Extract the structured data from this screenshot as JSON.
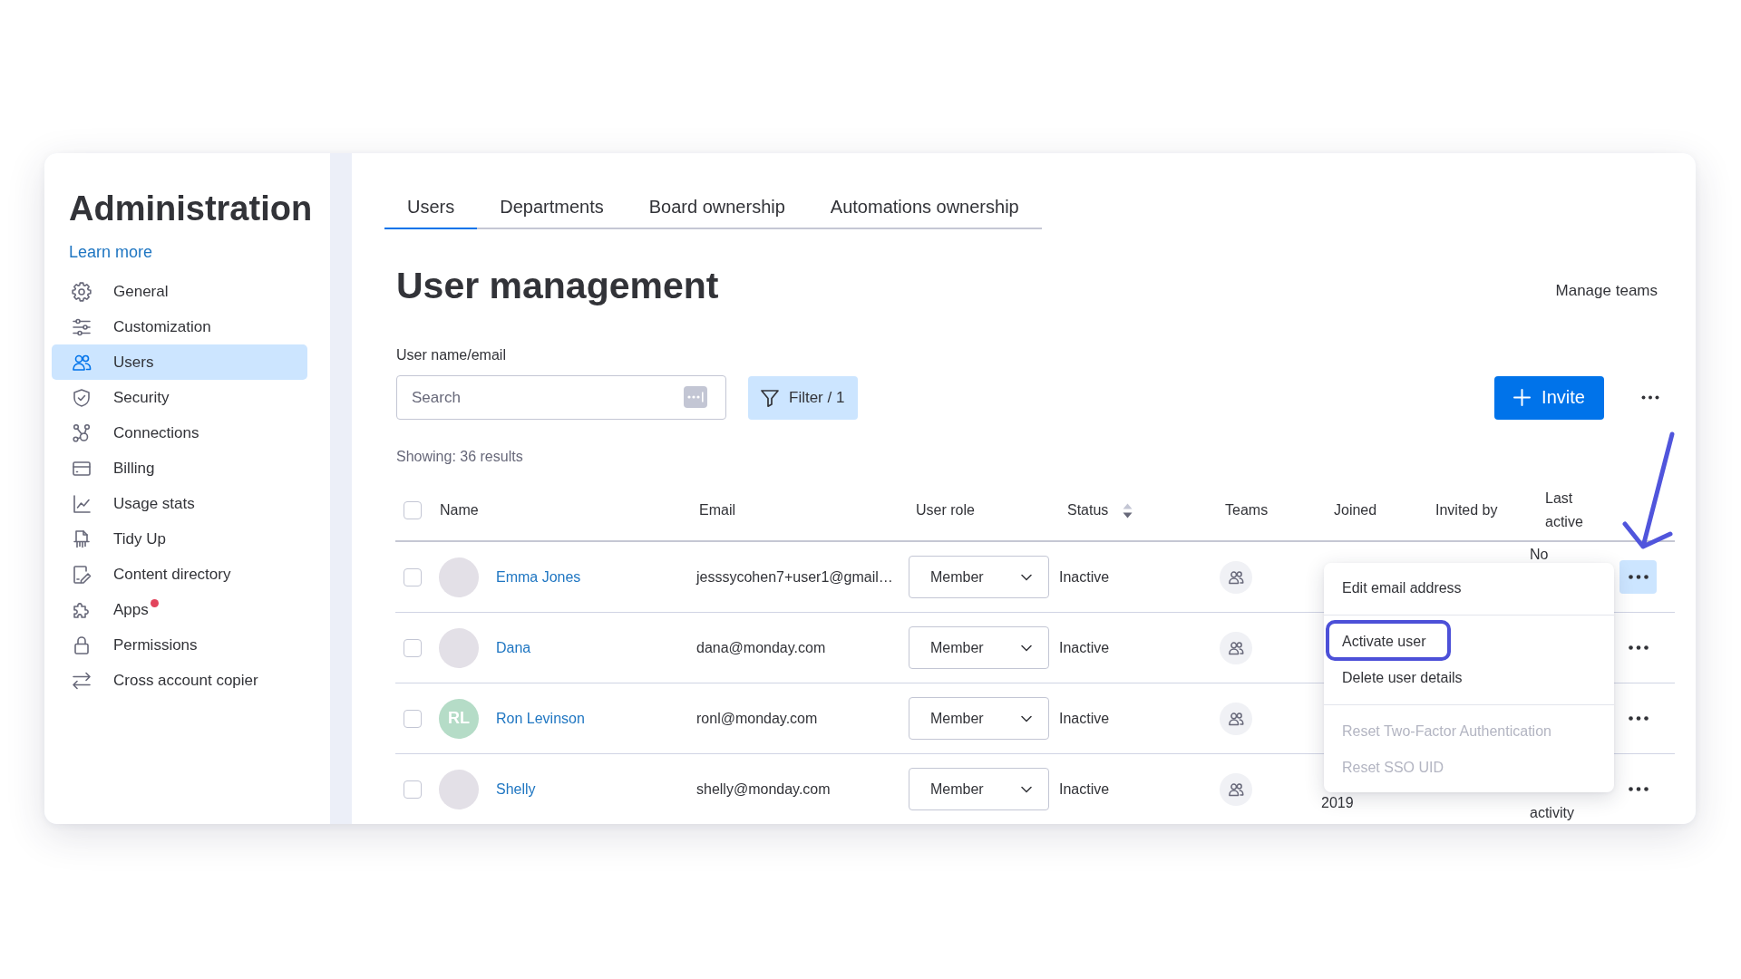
{
  "sidebar": {
    "title": "Administration",
    "learn_more": "Learn more",
    "items": [
      {
        "label": "General",
        "selected": false,
        "notification": false
      },
      {
        "label": "Customization",
        "selected": false,
        "notification": false
      },
      {
        "label": "Users",
        "selected": true,
        "notification": false
      },
      {
        "label": "Security",
        "selected": false,
        "notification": false
      },
      {
        "label": "Connections",
        "selected": false,
        "notification": false
      },
      {
        "label": "Billing",
        "selected": false,
        "notification": false
      },
      {
        "label": "Usage stats",
        "selected": false,
        "notification": false
      },
      {
        "label": "Tidy Up",
        "selected": false,
        "notification": false
      },
      {
        "label": "Content directory",
        "selected": false,
        "notification": false
      },
      {
        "label": "Apps",
        "selected": false,
        "notification": true
      },
      {
        "label": "Permissions",
        "selected": false,
        "notification": false
      },
      {
        "label": "Cross account copier",
        "selected": false,
        "notification": false
      }
    ]
  },
  "tabs": [
    {
      "label": "Users",
      "selected": true
    },
    {
      "label": "Departments",
      "selected": false
    },
    {
      "label": "Board ownership",
      "selected": false
    },
    {
      "label": "Automations ownership",
      "selected": false
    }
  ],
  "header": {
    "title": "User management",
    "manage_teams": "Manage teams"
  },
  "search": {
    "label": "User name/email",
    "placeholder": "Search"
  },
  "filter_button": {
    "label": "Filter / 1"
  },
  "invite_button": {
    "label": "Invite"
  },
  "results": "Showing: 36 results",
  "table": {
    "select_all": {
      "checked": false
    },
    "columns": [
      {
        "label": "Name",
        "sortable": false
      },
      {
        "label": "Email",
        "sortable": false
      },
      {
        "label": "User role",
        "sortable": false
      },
      {
        "label": "Status",
        "sortable": true
      },
      {
        "label": "Teams",
        "sortable": false
      },
      {
        "label": "Joined",
        "sortable": false
      },
      {
        "label": "Invited by",
        "sortable": false
      },
      {
        "label": "Last active",
        "sortable": false
      }
    ],
    "rows": [
      {
        "checked": false,
        "avatar": {
          "kind": "photo"
        },
        "name": "Emma Jones",
        "email": "jesssycohen7+user1@gmail…",
        "role": "Member",
        "status": "Inactive",
        "last_active": "No",
        "menu_open": true
      },
      {
        "checked": false,
        "avatar": {
          "kind": "photo"
        },
        "name": "Dana",
        "email": "dana@monday.com",
        "role": "Member",
        "status": "Inactive",
        "menu_open": false
      },
      {
        "checked": false,
        "avatar": {
          "kind": "initials",
          "initials": "RL",
          "color": "#b5dcc7"
        },
        "name": "Ron Levinson",
        "email": "ronl@monday.com",
        "role": "Member",
        "status": "Inactive",
        "menu_open": false
      },
      {
        "checked": false,
        "avatar": {
          "kind": "photo"
        },
        "name": "Shelly",
        "email": "shelly@monday.com",
        "role": "Member",
        "status": "Inactive",
        "joined": "2019",
        "last_active": "activity",
        "menu_open": false
      }
    ]
  },
  "row_menu": {
    "groups": [
      {
        "items": [
          {
            "label": "Edit email address",
            "disabled": false,
            "highlighted": false
          }
        ]
      },
      {
        "items": [
          {
            "label": "Activate user",
            "disabled": false,
            "highlighted": true
          },
          {
            "label": "Delete user details",
            "disabled": false,
            "highlighted": false
          }
        ]
      },
      {
        "items": [
          {
            "label": "Reset Two-Factor Authentication",
            "disabled": true,
            "highlighted": false
          },
          {
            "label": "Reset SSO UID",
            "disabled": true,
            "highlighted": false
          }
        ]
      }
    ]
  }
}
